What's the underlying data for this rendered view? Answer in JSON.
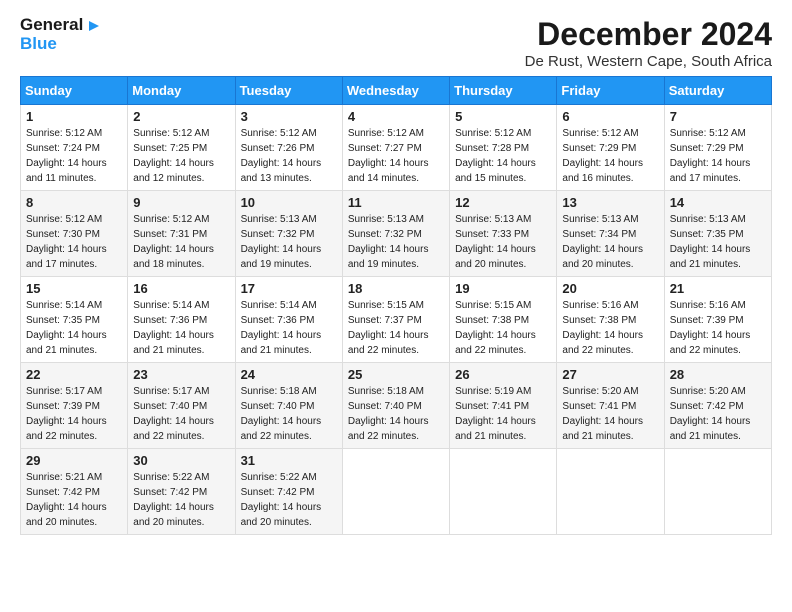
{
  "logo": {
    "text1": "General",
    "text2": "Blue"
  },
  "title": "December 2024",
  "location": "De Rust, Western Cape, South Africa",
  "weekdays": [
    "Sunday",
    "Monday",
    "Tuesday",
    "Wednesday",
    "Thursday",
    "Friday",
    "Saturday"
  ],
  "weeks": [
    [
      {
        "day": "1",
        "sunrise": "5:12 AM",
        "sunset": "7:24 PM",
        "daylight": "14 hours and 11 minutes."
      },
      {
        "day": "2",
        "sunrise": "5:12 AM",
        "sunset": "7:25 PM",
        "daylight": "14 hours and 12 minutes."
      },
      {
        "day": "3",
        "sunrise": "5:12 AM",
        "sunset": "7:26 PM",
        "daylight": "14 hours and 13 minutes."
      },
      {
        "day": "4",
        "sunrise": "5:12 AM",
        "sunset": "7:27 PM",
        "daylight": "14 hours and 14 minutes."
      },
      {
        "day": "5",
        "sunrise": "5:12 AM",
        "sunset": "7:28 PM",
        "daylight": "14 hours and 15 minutes."
      },
      {
        "day": "6",
        "sunrise": "5:12 AM",
        "sunset": "7:29 PM",
        "daylight": "14 hours and 16 minutes."
      },
      {
        "day": "7",
        "sunrise": "5:12 AM",
        "sunset": "7:29 PM",
        "daylight": "14 hours and 17 minutes."
      }
    ],
    [
      {
        "day": "8",
        "sunrise": "5:12 AM",
        "sunset": "7:30 PM",
        "daylight": "14 hours and 17 minutes."
      },
      {
        "day": "9",
        "sunrise": "5:12 AM",
        "sunset": "7:31 PM",
        "daylight": "14 hours and 18 minutes."
      },
      {
        "day": "10",
        "sunrise": "5:13 AM",
        "sunset": "7:32 PM",
        "daylight": "14 hours and 19 minutes."
      },
      {
        "day": "11",
        "sunrise": "5:13 AM",
        "sunset": "7:32 PM",
        "daylight": "14 hours and 19 minutes."
      },
      {
        "day": "12",
        "sunrise": "5:13 AM",
        "sunset": "7:33 PM",
        "daylight": "14 hours and 20 minutes."
      },
      {
        "day": "13",
        "sunrise": "5:13 AM",
        "sunset": "7:34 PM",
        "daylight": "14 hours and 20 minutes."
      },
      {
        "day": "14",
        "sunrise": "5:13 AM",
        "sunset": "7:35 PM",
        "daylight": "14 hours and 21 minutes."
      }
    ],
    [
      {
        "day": "15",
        "sunrise": "5:14 AM",
        "sunset": "7:35 PM",
        "daylight": "14 hours and 21 minutes."
      },
      {
        "day": "16",
        "sunrise": "5:14 AM",
        "sunset": "7:36 PM",
        "daylight": "14 hours and 21 minutes."
      },
      {
        "day": "17",
        "sunrise": "5:14 AM",
        "sunset": "7:36 PM",
        "daylight": "14 hours and 21 minutes."
      },
      {
        "day": "18",
        "sunrise": "5:15 AM",
        "sunset": "7:37 PM",
        "daylight": "14 hours and 22 minutes."
      },
      {
        "day": "19",
        "sunrise": "5:15 AM",
        "sunset": "7:38 PM",
        "daylight": "14 hours and 22 minutes."
      },
      {
        "day": "20",
        "sunrise": "5:16 AM",
        "sunset": "7:38 PM",
        "daylight": "14 hours and 22 minutes."
      },
      {
        "day": "21",
        "sunrise": "5:16 AM",
        "sunset": "7:39 PM",
        "daylight": "14 hours and 22 minutes."
      }
    ],
    [
      {
        "day": "22",
        "sunrise": "5:17 AM",
        "sunset": "7:39 PM",
        "daylight": "14 hours and 22 minutes."
      },
      {
        "day": "23",
        "sunrise": "5:17 AM",
        "sunset": "7:40 PM",
        "daylight": "14 hours and 22 minutes."
      },
      {
        "day": "24",
        "sunrise": "5:18 AM",
        "sunset": "7:40 PM",
        "daylight": "14 hours and 22 minutes."
      },
      {
        "day": "25",
        "sunrise": "5:18 AM",
        "sunset": "7:40 PM",
        "daylight": "14 hours and 22 minutes."
      },
      {
        "day": "26",
        "sunrise": "5:19 AM",
        "sunset": "7:41 PM",
        "daylight": "14 hours and 21 minutes."
      },
      {
        "day": "27",
        "sunrise": "5:20 AM",
        "sunset": "7:41 PM",
        "daylight": "14 hours and 21 minutes."
      },
      {
        "day": "28",
        "sunrise": "5:20 AM",
        "sunset": "7:42 PM",
        "daylight": "14 hours and 21 minutes."
      }
    ],
    [
      {
        "day": "29",
        "sunrise": "5:21 AM",
        "sunset": "7:42 PM",
        "daylight": "14 hours and 20 minutes."
      },
      {
        "day": "30",
        "sunrise": "5:22 AM",
        "sunset": "7:42 PM",
        "daylight": "14 hours and 20 minutes."
      },
      {
        "day": "31",
        "sunrise": "5:22 AM",
        "sunset": "7:42 PM",
        "daylight": "14 hours and 20 minutes."
      },
      null,
      null,
      null,
      null
    ]
  ]
}
